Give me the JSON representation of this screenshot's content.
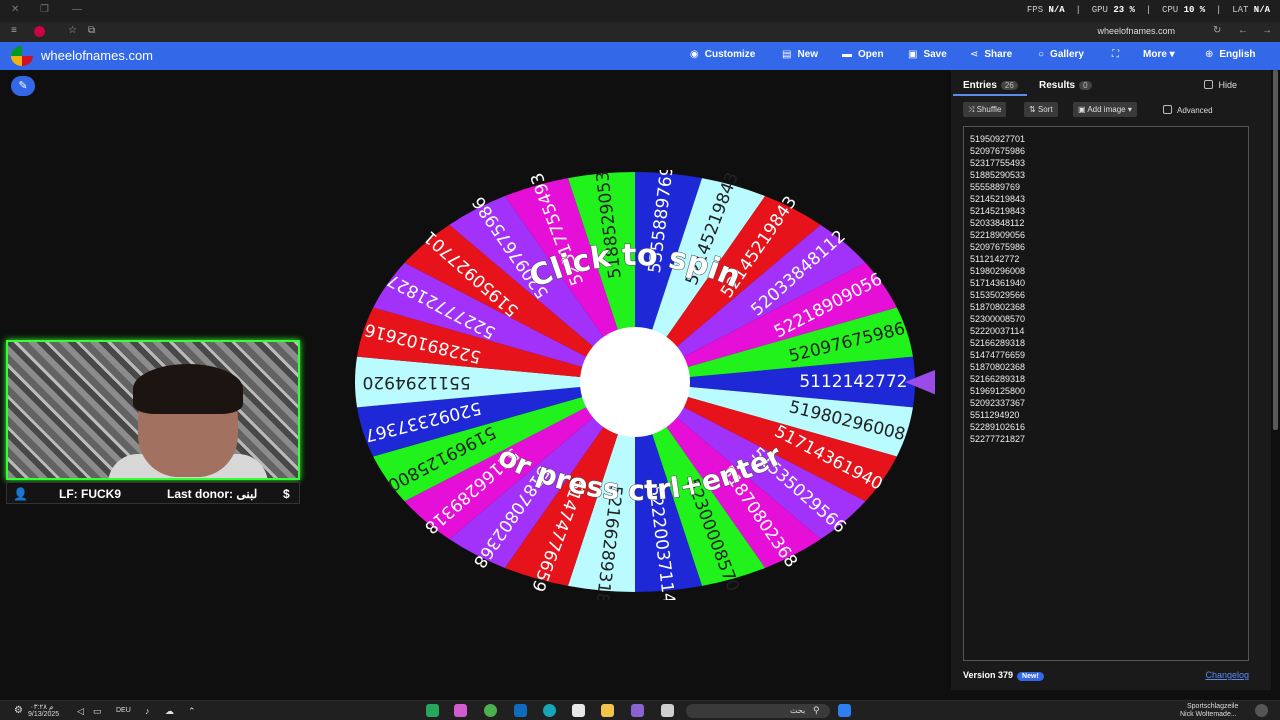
{
  "browser": {
    "overlay": {
      "fps_label": "FPS",
      "fps_value": "N/A",
      "gpu_label": "GPU",
      "gpu_value": "23 %",
      "cpu_label": "CPU",
      "cpu_value": "10 %",
      "lat_label": "LAT",
      "lat_value": "N/A"
    },
    "url": "wheelofnames.com"
  },
  "nav": {
    "site": "wheelofnames.com",
    "items": [
      {
        "label": "Customize",
        "icon": "palette-icon",
        "glyph": "◉"
      },
      {
        "label": "New",
        "icon": "file-icon",
        "glyph": "▤"
      },
      {
        "label": "Open",
        "icon": "folder-icon",
        "glyph": "▬"
      },
      {
        "label": "Save",
        "icon": "save-icon",
        "glyph": "▣"
      },
      {
        "label": "Share",
        "icon": "share-icon",
        "glyph": "⋖"
      },
      {
        "label": "Gallery",
        "icon": "search-icon",
        "glyph": "○"
      },
      {
        "label": "",
        "icon": "fullscreen-icon",
        "glyph": "⛶"
      },
      {
        "label": "More ▾",
        "icon": "",
        "glyph": ""
      },
      {
        "label": "English",
        "icon": "globe-icon",
        "glyph": "⊕"
      }
    ]
  },
  "wheel": {
    "hint_top": "Click to spin",
    "hint_bottom": "or press ctrl+enter",
    "segment_colors": [
      "#e6131b",
      "#a231fa",
      "#e60fd8",
      "#21f21b",
      "#1e28d6",
      "#b9fbff"
    ],
    "segments": [
      "51950927701",
      "52097675986",
      "52317755493",
      "51885290533",
      "5555889769",
      "52145219843",
      "52145219843",
      "52033848112",
      "52218909056",
      "52097675986",
      "5112142772",
      "51980296008",
      "51714361940",
      "51535029566",
      "51870802368",
      "52300008570",
      "52220037114",
      "52166289318",
      "51474776659",
      "51870802368",
      "52166289318",
      "51969125800",
      "52092337367",
      "5511294920",
      "52289102616",
      "52277721827"
    ]
  },
  "stream": {
    "lf": "LF: FUCK9",
    "donor": "Last donor: لبنى",
    "dollar": "$"
  },
  "panel": {
    "tab_entries": "Entries",
    "entries_count": "26",
    "tab_results": "Results",
    "results_count": "0",
    "hide": "Hide",
    "shuffle": "Shuffle",
    "sort": "Sort",
    "add_image": "Add image ▾",
    "advanced": "Advanced",
    "entries": [
      "51950927701",
      "52097675986",
      "52317755493",
      "51885290533",
      "5555889769",
      "52145219843",
      "52145219843",
      "52033848112",
      "52218909056",
      "52097675986",
      "5112142772",
      "51980296008",
      "51714361940",
      "51535029566",
      "51870802368",
      "52300008570",
      "52220037114",
      "52166289318",
      "51474776659",
      "51870802368",
      "52166289318",
      "51969125800",
      "52092337367",
      "5511294920",
      "52289102616",
      "52277721827"
    ],
    "version": "Version 379",
    "new_badge": "New!",
    "changelog": "Changelog"
  },
  "taskbar": {
    "clock": "۰۳:۲۸ م",
    "date": "9/13/2025",
    "lang": "DEU",
    "search": "بحث",
    "tray1": "Sportschlagzeile",
    "tray2": "Nick Woltemade..."
  }
}
